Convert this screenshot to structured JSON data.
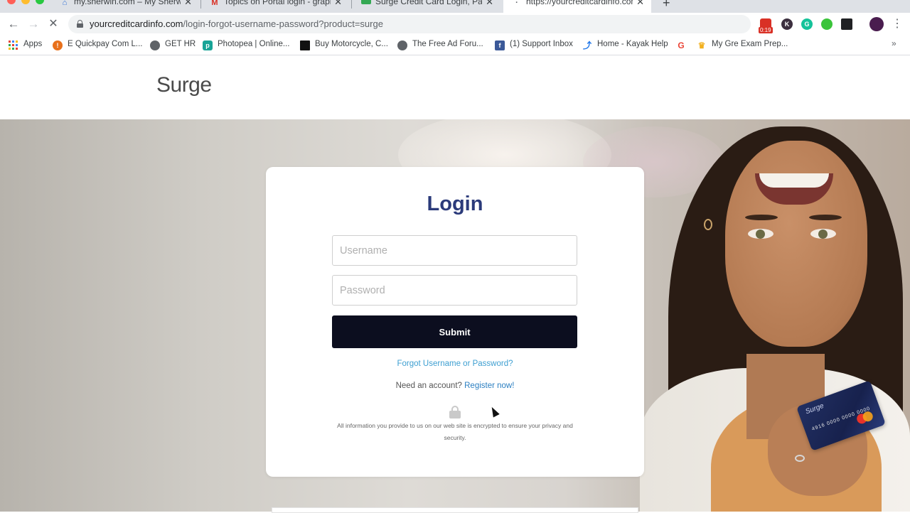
{
  "browser": {
    "tabs": [
      {
        "title": "my.sherwin.com – My Sherwin",
        "favicon": "house-icon",
        "color": "#2f6fd6"
      },
      {
        "title": "Topics on Portal login - graphic",
        "favicon": "gmail-icon",
        "color": "#d93025"
      },
      {
        "title": "Surge Credit Card Login, Paym",
        "favicon": "card-icon",
        "color": "#34a853"
      },
      {
        "title": "https://yourcreditcardinfo.com",
        "favicon": "loading-icon",
        "color": "#5f6368"
      }
    ],
    "address": {
      "domain": "yourcreditcardinfo.com",
      "path": "/login-forgot-username-password?product=surge"
    },
    "extension_badge": "0:19",
    "bookmarks": [
      {
        "label": "Apps",
        "icon": "apps-grid-icon"
      },
      {
        "label": "E Quickpay Com L...",
        "icon": "quickpay-icon",
        "color": "#e8711c"
      },
      {
        "label": "GET HR",
        "icon": "globe-icon",
        "color": "#5f6368"
      },
      {
        "label": "Photopea | Online...",
        "icon": "photopea-icon",
        "color": "#18a497"
      },
      {
        "label": "Buy Motorcycle, C...",
        "icon": "motorcycle-site-icon",
        "color": "#111111"
      },
      {
        "label": "The Free Ad Foru...",
        "icon": "globe-icon",
        "color": "#5f6368"
      },
      {
        "label": "(1) Support Inbox",
        "icon": "facebook-icon",
        "color": "#3b5998"
      },
      {
        "label": "Home - Kayak Help",
        "icon": "kayak-icon",
        "color": "#1a73e8"
      },
      {
        "label": "",
        "icon": "google-icon",
        "color": "#ea4335"
      },
      {
        "label": "My Gre Exam Prep...",
        "icon": "crown-icon",
        "color": "#f2b01e"
      }
    ]
  },
  "site": {
    "logo": "Surge"
  },
  "login": {
    "title": "Login",
    "username_placeholder": "Username",
    "password_placeholder": "Password",
    "submit_label": "Submit",
    "forgot_link": "Forgot Username or Password?",
    "need_account": "Need an account?",
    "register_link": "Register now!",
    "security_note": "All information you provide to us on our web site is encrypted to ensure your privacy and security."
  },
  "hero_card": {
    "brand": "Surge",
    "number": "4916 0000 0000 0000"
  },
  "colors": {
    "title_navy": "#2b3a7a",
    "submit_bg": "#0c0e1f",
    "link_blue": "#3e9fd1"
  }
}
